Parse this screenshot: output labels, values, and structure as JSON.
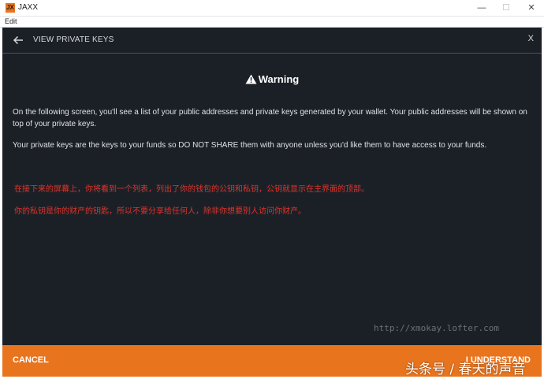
{
  "window": {
    "app_icon": "JX",
    "title": "JAXX",
    "minimize": "—",
    "maximize": "☐",
    "close": "✕"
  },
  "menu": {
    "edit": "Edit"
  },
  "header": {
    "back_icon": "back-arrow-icon",
    "title": "VIEW PRIVATE KEYS",
    "close": "X"
  },
  "warning": {
    "icon": "warning-triangle-icon",
    "title": "Warning"
  },
  "body": {
    "paragraph1": "On the following screen, you'll see a list of your public addresses and private keys generated by your wallet. Your public addresses will be shown on top of your private keys.",
    "paragraph2": "Your private keys are the keys to your funds so DO NOT SHARE them with anyone unless you'd like them to have access to your funds.",
    "translation1": "在接下来的屏幕上，你将看到一个列表，列出了你的钱包的公钥和私钥，公钥就显示在主界面的顶部。",
    "translation2": "你的私钥是你的财产的钥匙，所以不要分享给任何人，除非你想要别人访问你财产。"
  },
  "watermarks": {
    "url": "http://xmokay.lofter.com",
    "brand": "头条号 / 春天的声音"
  },
  "footer": {
    "cancel": "CANCEL",
    "understand": "I UNDERSTAND"
  },
  "colors": {
    "accent": "#e8741e",
    "background": "#1b2027",
    "translation_text": "#e0342a"
  }
}
